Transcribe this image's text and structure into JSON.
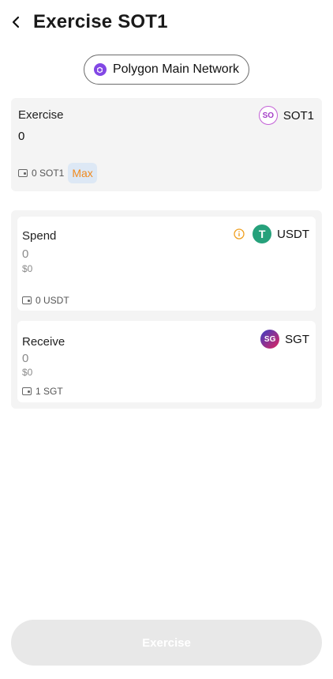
{
  "header": {
    "title": "Exercise SOT1"
  },
  "network": {
    "label": "Polygon Main Network"
  },
  "exercise": {
    "label": "Exercise",
    "value": "0",
    "token": "SOT1",
    "balance": "0 SOT1",
    "max_label": "Max"
  },
  "spend": {
    "label": "Spend",
    "value": "0",
    "usd": "$0",
    "token": "USDT",
    "balance": "0 USDT"
  },
  "receive": {
    "label": "Receive",
    "value": "0",
    "usd": "$0",
    "token": "SGT",
    "balance": "1 SGT"
  },
  "footer": {
    "button_label": "Exercise"
  },
  "colors": {
    "polygon": "#8247e5",
    "usdt": "#26a17b",
    "accent_orange": "#f08a1f"
  }
}
